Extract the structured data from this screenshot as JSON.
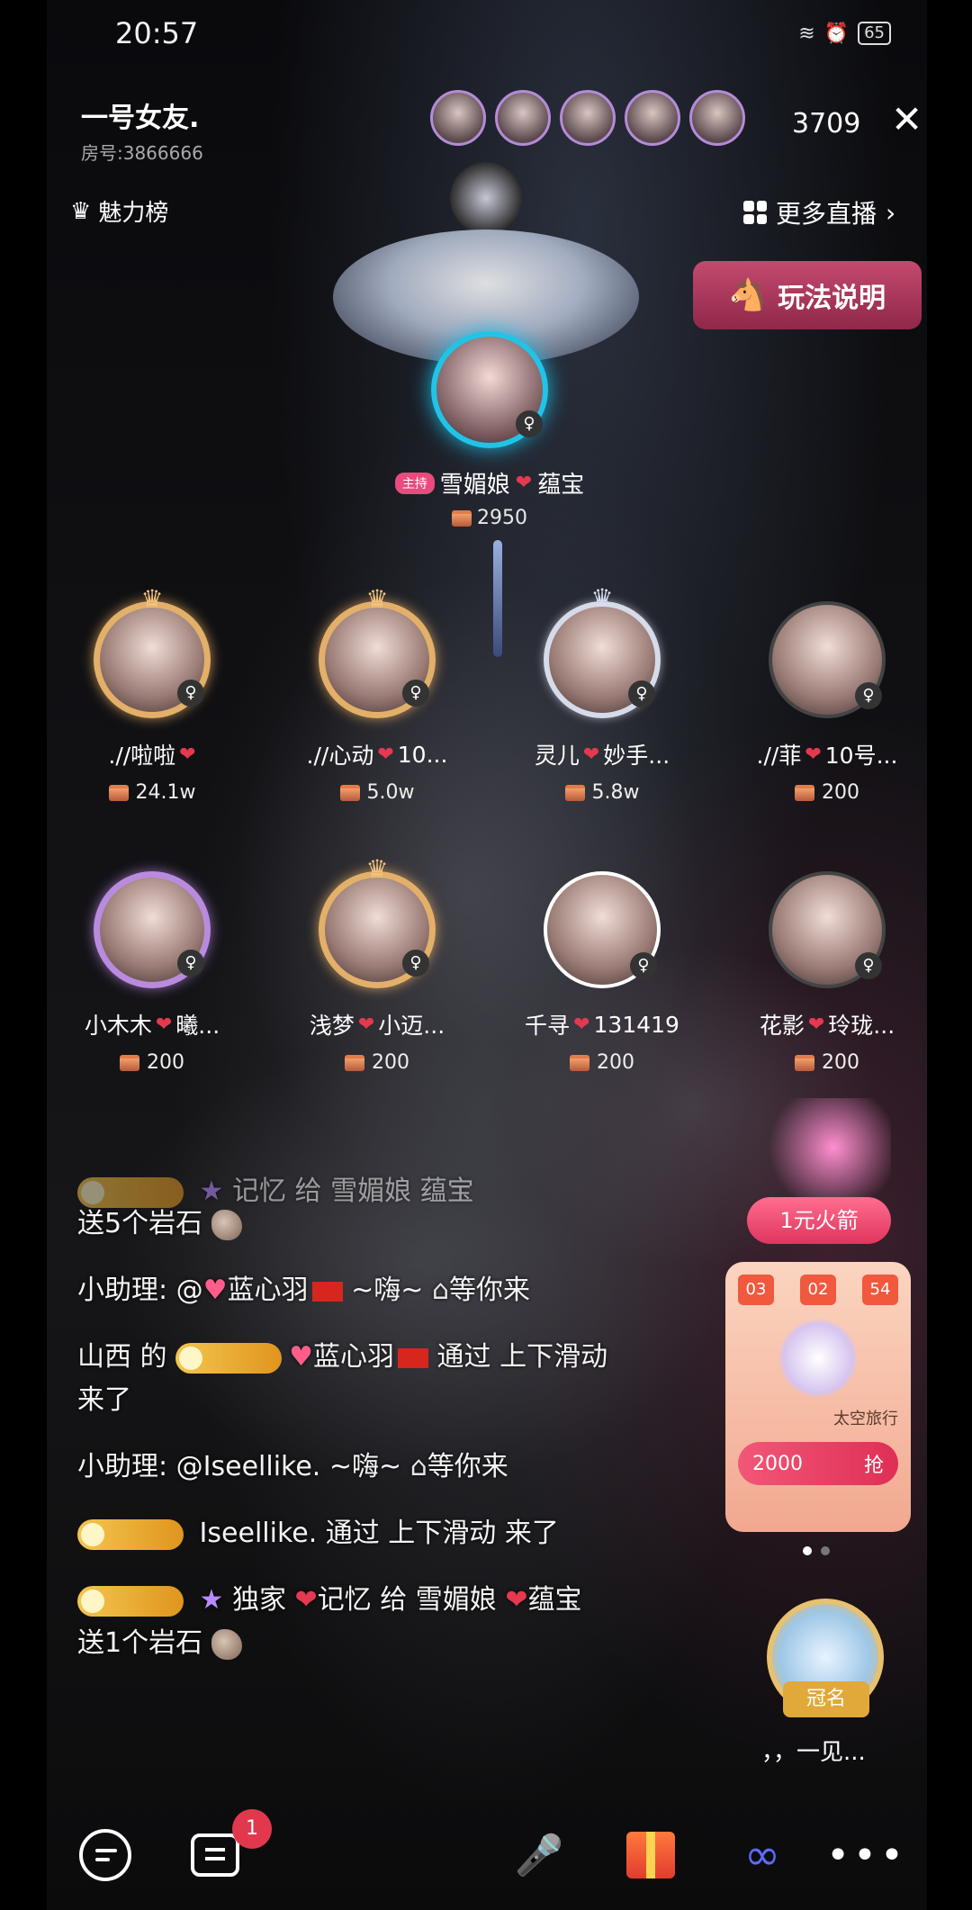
{
  "status": {
    "time": "20:57",
    "battery": "65"
  },
  "room": {
    "title": "一号女友.",
    "id": "房号:3866666",
    "viewers": "3709"
  },
  "header": {
    "charm_rank": "魅力榜",
    "more_live": "更多直播",
    "rules_button": "玩法说明",
    "close_icon": "close-icon"
  },
  "host": {
    "tag": "主持",
    "name": "雪媚娘",
    "suffix": "蕴宝",
    "score": "2950"
  },
  "seats": [
    {
      "name": ".//啦啦",
      "score": "24.1w"
    },
    {
      "name": ".//心动",
      "name_suffix": "10...",
      "score": "5.0w"
    },
    {
      "name": "灵儿",
      "name_suffix": "妙手...",
      "score": "5.8w"
    },
    {
      "name": ".//菲",
      "name_suffix": "10号...",
      "score": "200"
    },
    {
      "name": "小木木",
      "name_suffix": "曦...",
      "score": "200"
    },
    {
      "name": "浅梦",
      "name_suffix": "小迈...",
      "score": "200"
    },
    {
      "name": "千寻",
      "name_suffix": "131419",
      "score": "200"
    },
    {
      "name": "花影",
      "name_suffix": "玲珑...",
      "score": "200"
    }
  ],
  "chat": {
    "msg0_text": "记忆 给 雪媚娘 蕴宝",
    "msg0_line2": "送5个岩石",
    "msg1_prefix": "小助理: @",
    "msg1_name": "蓝心羽",
    "msg1_suffix": "~嗨~",
    "msg1_tail": "等你来",
    "msg2_prefix": "山西 的",
    "msg2_name": "蓝心羽",
    "msg2_suffix": "通过 上下滑动",
    "msg2_line2": "来了",
    "msg3_prefix": "小助理: @Iseellike. ~嗨~",
    "msg3_tail": "等你来",
    "msg4_text": "Iseellike. 通过 上下滑动 来了",
    "msg5_name": "独家",
    "msg5_text": "记忆 给 雪媚娘",
    "msg5_suffix": "蕴宝",
    "msg5_line2": "送1个岩石"
  },
  "promo": {
    "title": "1元火箭",
    "timer": [
      "03",
      "02",
      "54"
    ],
    "item": "太空旅行",
    "price": "2000",
    "price_action": "抢"
  },
  "badge": {
    "label": "冠名",
    "caption": "，，一见..."
  },
  "bottom": {
    "notif_count": "1"
  }
}
